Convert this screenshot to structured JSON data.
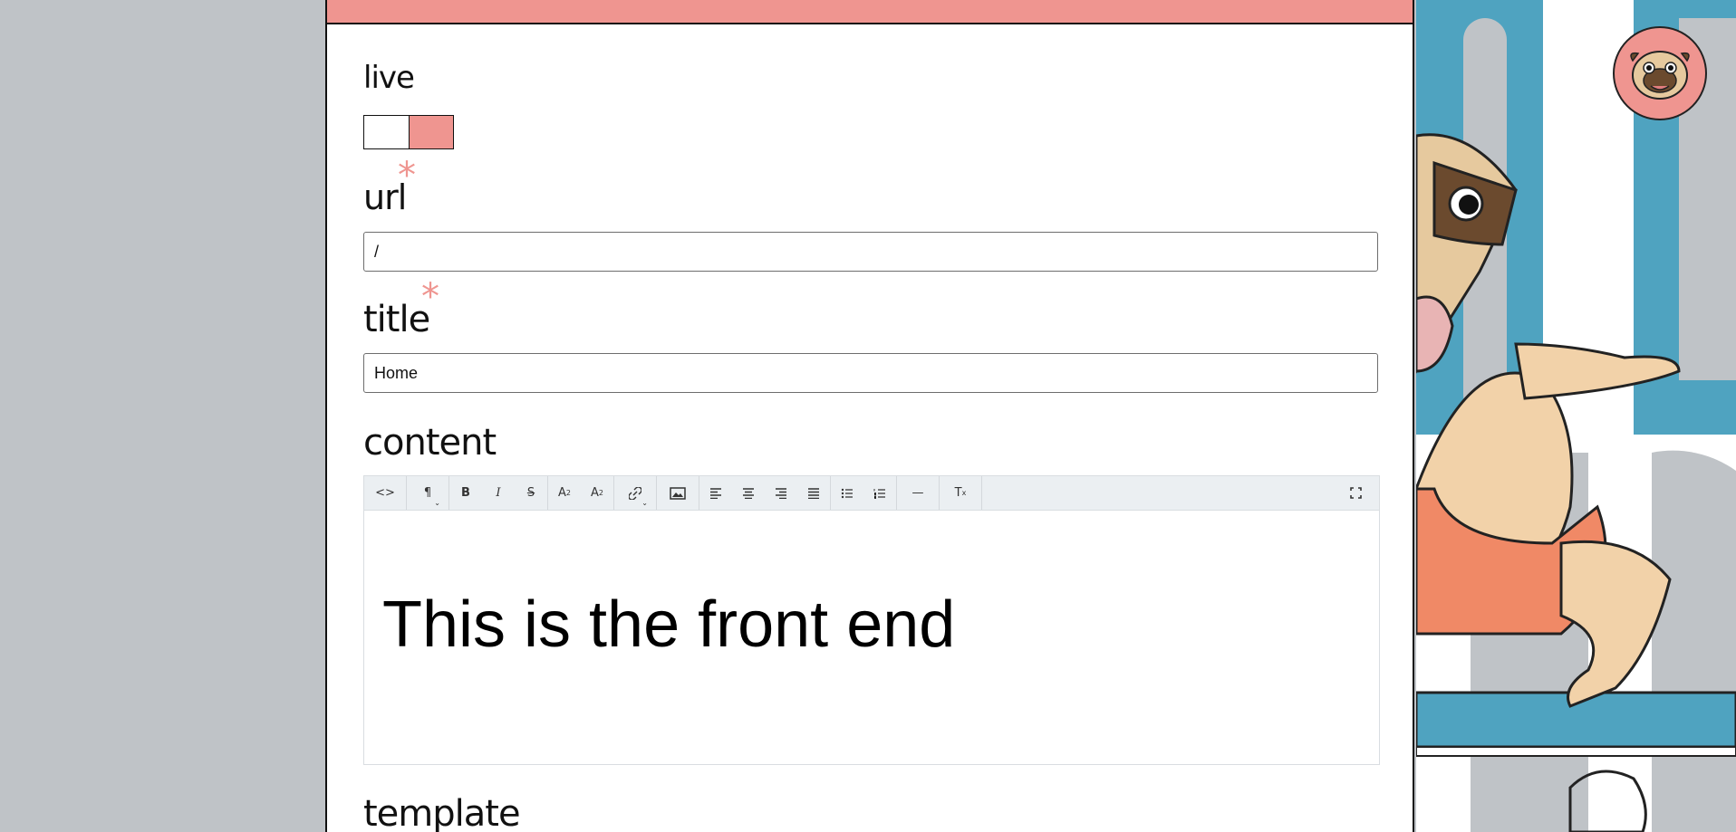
{
  "fields": {
    "live": {
      "label": "live",
      "toggle_on": true
    },
    "url": {
      "label": "url",
      "required_mark": "*",
      "value": "/"
    },
    "title": {
      "label": "title",
      "required_mark": "*",
      "value": "Home"
    },
    "content": {
      "label": "content",
      "body_text": "This is the front end"
    },
    "template": {
      "label": "template"
    }
  },
  "toolbar": {
    "groups": [
      [
        {
          "icon": "code-view-icon",
          "glyph": "<>"
        }
      ],
      [
        {
          "icon": "paragraph-format-icon",
          "glyph": "¶",
          "dropdown": true
        }
      ],
      [
        {
          "icon": "bold-icon",
          "glyph": "B"
        },
        {
          "icon": "italic-icon",
          "glyph": "I"
        },
        {
          "icon": "strikethrough-icon",
          "glyph": "S"
        }
      ],
      [
        {
          "icon": "superscript-icon",
          "glyph": "A²"
        },
        {
          "icon": "subscript-icon",
          "glyph": "A₂"
        }
      ],
      [
        {
          "icon": "link-icon",
          "glyph": "🔗",
          "dropdown": true
        }
      ],
      [
        {
          "icon": "image-icon",
          "glyph": "▣"
        }
      ],
      [
        {
          "icon": "align-left-icon",
          "glyph": "≡"
        },
        {
          "icon": "align-center-icon",
          "glyph": "≡"
        },
        {
          "icon": "align-right-icon",
          "glyph": "≡"
        },
        {
          "icon": "align-justify-icon",
          "glyph": "≡"
        }
      ],
      [
        {
          "icon": "bulleted-list-icon",
          "glyph": "☰"
        },
        {
          "icon": "numbered-list-icon",
          "glyph": "☰"
        }
      ],
      [
        {
          "icon": "horizontal-rule-icon",
          "glyph": "—"
        }
      ],
      [
        {
          "icon": "clear-formatting-icon",
          "glyph": "Tₓ"
        }
      ]
    ],
    "fullscreen_icon": "fullscreen-icon"
  },
  "colors": {
    "accent": "#ef9590",
    "backdrop_blue": "#4fa3c0",
    "gutter": "#bfc3c7"
  },
  "avatar_icon": "pug-avatar-icon"
}
